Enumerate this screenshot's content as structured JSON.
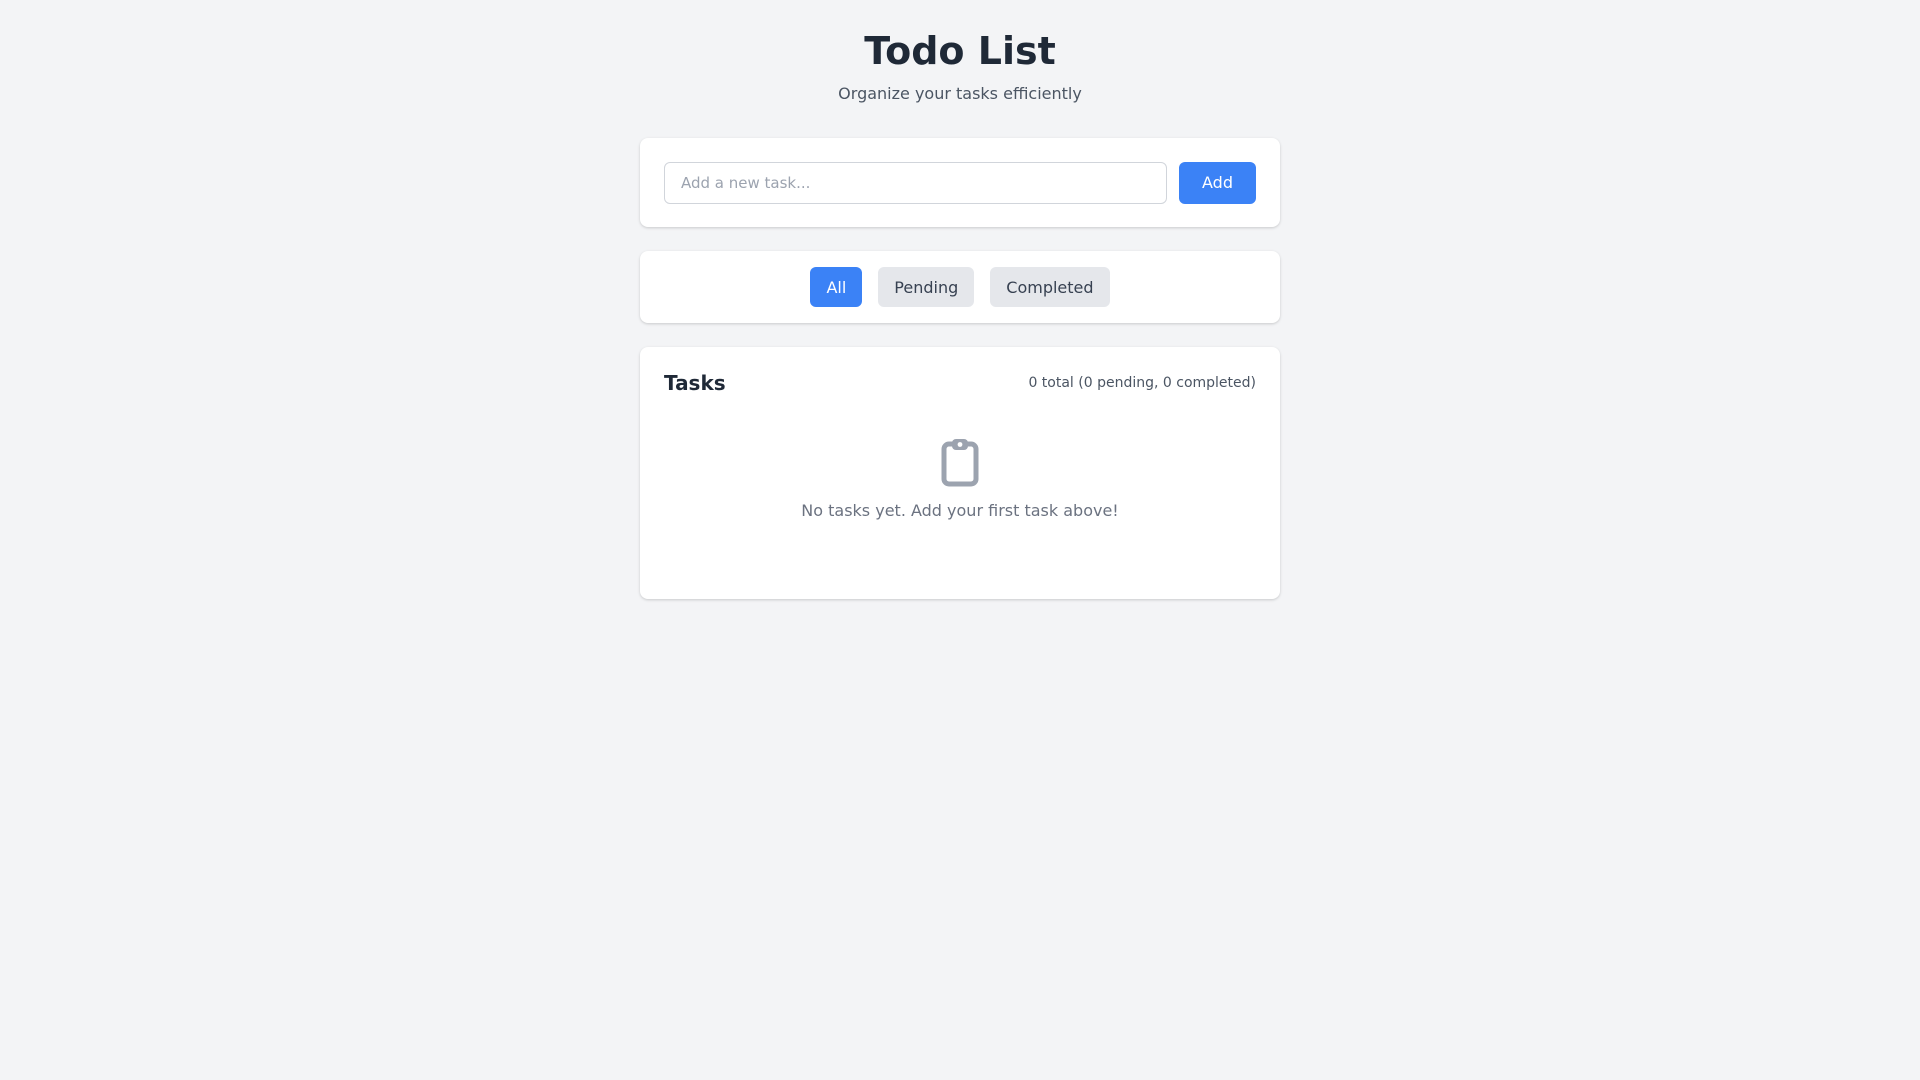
{
  "header": {
    "title": "Todo List",
    "subtitle": "Organize your tasks efficiently"
  },
  "add_form": {
    "input_value": "",
    "input_placeholder": "Add a new task...",
    "add_label": "Add"
  },
  "filters": {
    "items": [
      {
        "label": "All",
        "active": true
      },
      {
        "label": "Pending",
        "active": false
      },
      {
        "label": "Completed",
        "active": false
      }
    ]
  },
  "tasks": {
    "title": "Tasks",
    "count_text": "0 total (0 pending, 0 completed)",
    "empty_icon": "clipboard-icon",
    "empty_text": "No tasks yet. Add your first task above!",
    "items": []
  },
  "colors": {
    "accent": "#3b82f6",
    "background": "#f3f4f6",
    "card": "#ffffff",
    "inactive_button": "#e5e7eb"
  }
}
